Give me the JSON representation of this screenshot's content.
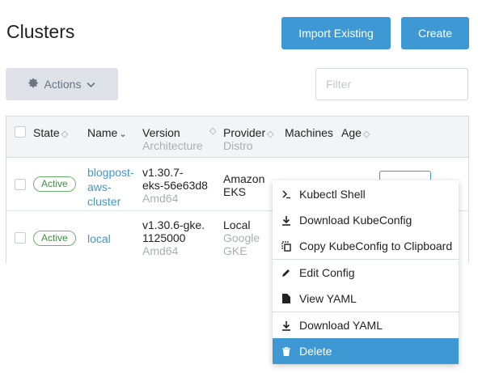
{
  "header": {
    "title": "Clusters",
    "import_label": "Import Existing",
    "create_label": "Create"
  },
  "toolbar": {
    "actions_label": "Actions",
    "filter_placeholder": "Filter"
  },
  "table": {
    "columns": {
      "state": "State",
      "name": "Name",
      "version": "Version",
      "version_sub": "Architecture",
      "provider": "Provider",
      "provider_sub": "Distro",
      "machines": "Machines",
      "age": "Age"
    },
    "rows": [
      {
        "state": "Active",
        "name_lines": [
          "blogpost-",
          "aws-",
          "cluster"
        ],
        "version_lines": [
          "v1.30.7-",
          "eks-56e63d8"
        ],
        "arch": "Amd64",
        "provider": "Amazon",
        "distro": "EKS"
      },
      {
        "state": "Active",
        "name_lines": [
          "local"
        ],
        "version_lines": [
          "v1.30.6-gke.",
          "1125000"
        ],
        "arch": "Amd64",
        "provider": "Local",
        "distro_lines": [
          "Google",
          "GKE"
        ]
      }
    ]
  },
  "menu": {
    "items": [
      {
        "label": "Kubectl Shell",
        "icon": "terminal-icon"
      },
      {
        "label": "Download KubeConfig",
        "icon": "download-icon"
      },
      {
        "label": "Copy KubeConfig to Clipboard",
        "icon": "copy-icon"
      },
      {
        "label": "Edit Config",
        "icon": "pencil-icon"
      },
      {
        "label": "View YAML",
        "icon": "file-icon"
      },
      {
        "label": "Download YAML",
        "icon": "download-icon"
      },
      {
        "label": "Delete",
        "icon": "trash-icon"
      }
    ]
  },
  "colors": {
    "primary": "#3d98d3",
    "active_badge": "#3f8f3f",
    "table_header_bg": "#f2f4f7",
    "actions_bg": "#dfe3e9"
  }
}
